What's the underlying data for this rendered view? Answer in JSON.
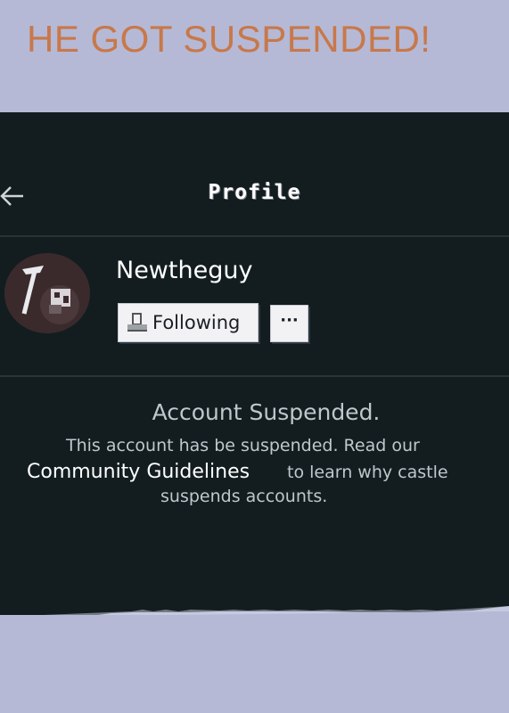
{
  "meme": {
    "caption": "HE GOT SUSPENDED!"
  },
  "header": {
    "title": "Profile",
    "back_icon": "arrow-left-icon"
  },
  "profile": {
    "username": "Newtheguy",
    "avatar_icon": "pickaxe-icon",
    "follow_button": {
      "icon": "user-check-icon",
      "label": "Following"
    },
    "more_button": {
      "label": "···"
    }
  },
  "suspension": {
    "title": "Account Suspended.",
    "line1": "This account has be suspended. Read our",
    "link_text": "Community Guidelines",
    "line2": "to learn why castle",
    "line3": "suspends accounts."
  },
  "colors": {
    "background": "#b5b9d6",
    "screen": "#131d20",
    "caption": "#c8784a",
    "text_light": "#ffffff",
    "text_muted": "#bfc7cc",
    "button_bg": "#f2f2f5"
  }
}
